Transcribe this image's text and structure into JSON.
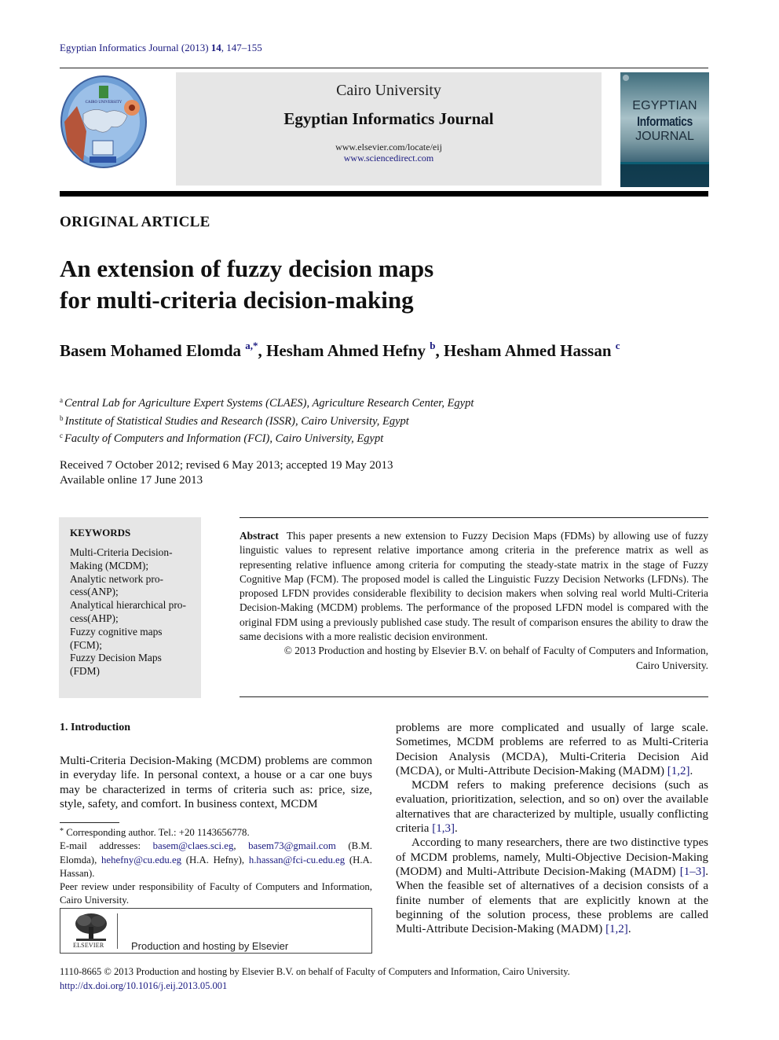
{
  "citation": {
    "journal": "Egyptian Informatics Journal (2013)",
    "volume": "14",
    "pages": ", 147–155"
  },
  "masthead": {
    "university": "Cairo University",
    "journal_name": "Egyptian Informatics Journal",
    "url_locate": "www.elsevier.com/locate/eij",
    "url_sciencedirect": "www.sciencedirect.com",
    "cover": {
      "line1": "EGYPTIAN",
      "line2": "Informatics",
      "line3": "JOURNAL"
    }
  },
  "article": {
    "type": "ORIGINAL ARTICLE",
    "title_line1": "An extension of fuzzy decision maps",
    "title_line2": "for multi-criteria decision-making",
    "authors": [
      {
        "name": "Basem Mohamed Elomda",
        "sup": "a,*",
        "sep": ", "
      },
      {
        "name": "Hesham Ahmed Hefny",
        "sup": "b",
        "sep": ", "
      },
      {
        "name": "Hesham Ahmed Hassan",
        "sup": "c",
        "sep": ""
      }
    ],
    "affiliations": [
      {
        "mark": "a",
        "text": "Central Lab for Agriculture Expert Systems (CLAES), Agriculture Research Center, Egypt"
      },
      {
        "mark": "b",
        "text": "Institute of Statistical Studies and Research (ISSR), Cairo University, Egypt"
      },
      {
        "mark": "c",
        "text": "Faculty of Computers and Information (FCI), Cairo University, Egypt"
      }
    ],
    "dates_line1": "Received 7 October 2012; revised 6 May 2013; accepted 19 May 2013",
    "dates_line2": "Available online 17 June 2013"
  },
  "keywords": {
    "heading": "KEYWORDS",
    "items": [
      "Multi-Criteria Decision-",
      "Making (MCDM);",
      "Analytic network pro-",
      "cess(ANP);",
      "Analytical hierarchical pro-",
      "cess(AHP);",
      "Fuzzy cognitive maps",
      "(FCM);",
      "Fuzzy Decision Maps",
      "(FDM)"
    ]
  },
  "abstract": {
    "label": "Abstract",
    "text": "This paper presents a new extension to Fuzzy Decision Maps (FDMs) by allowing use of fuzzy linguistic values to represent relative importance among criteria in the preference matrix as well as representing relative influence among criteria for computing the steady-state matrix in the stage of Fuzzy Cognitive Map (FCM). The proposed model is called the Linguistic Fuzzy Decision Networks (LFDNs). The proposed LFDN provides considerable flexibility to decision makers when solving real world Multi-Criteria Decision-Making (MCDM) problems. The performance of the proposed LFDN model is compared with the original FDM using a previously published case study. The result of comparison ensures the ability to draw the same decisions with a more realistic decision environment.",
    "copyright_line1": "© 2013 Production and hosting by Elsevier B.V. on behalf of Faculty of Computers and Information,",
    "copyright_line2": "Cairo University."
  },
  "introduction": {
    "heading": "1. Introduction",
    "left_para": "Multi-Criteria Decision-Making (MCDM) problems are common in everyday life. In personal context, a house or a car one buys may be characterized in terms of criteria such as: price, size, style, safety, and comfort. In business context, MCDM",
    "right_para1_text": "problems are more complicated and usually of large scale. Sometimes, MCDM problems are referred to as Multi-Criteria Decision Analysis (MCDA), Multi-Criteria Decision Aid (MCDA), or Multi-Attribute Decision-Making (MADM) ",
    "right_para1_ref": "[1,2]",
    "right_para2_text": "MCDM refers to making preference decisions (such as evaluation, prioritization, selection, and so on) over the available alternatives that are characterized by multiple, usually conflicting criteria ",
    "right_para2_ref": "[1,3]",
    "right_para3_text_a": "According to many researchers, there are two distinctive types of MCDM problems, namely, Multi-Objective Decision-Making (MODM) and Multi-Attribute Decision-Making (MADM) ",
    "right_para3_ref_a": "[1–3]",
    "right_para3_text_b": ". When the feasible set of alternatives of a decision consists of a finite number of elements that are explicitly known at the beginning of the solution process, these problems are called Multi-Attribute Decision-Making (MADM) ",
    "right_para3_ref_b": "[1,2]",
    "period": "."
  },
  "footnotes": {
    "corresponding_mark": "*",
    "corresponding": " Corresponding author. Tel.: +20 1143656778.",
    "email_label": "E-mail addresses: ",
    "email1": "basem@claes.sci.eg",
    "sep1": ", ",
    "email2": "basem73@gmail.com",
    "owner12": " (B.M. Elomda), ",
    "email3": "hehefny@cu.edu.eg",
    "owner3": " (H.A. Hefny), ",
    "email4": "h.hassan@fci-cu.edu.eg",
    "owner4": " (H.A. Hassan).",
    "peer_review": "Peer review under responsibility of Faculty of Computers and Information, Cairo University."
  },
  "publisher_box": {
    "logo_label": "ELSEVIER",
    "text": "Production and hosting by Elsevier"
  },
  "footer": {
    "line1": "1110-8665 © 2013 Production and hosting by Elsevier B.V. on behalf of Faculty of Computers and Information, Cairo University.",
    "doi": "http://dx.doi.org/10.1016/j.eij.2013.05.001"
  }
}
